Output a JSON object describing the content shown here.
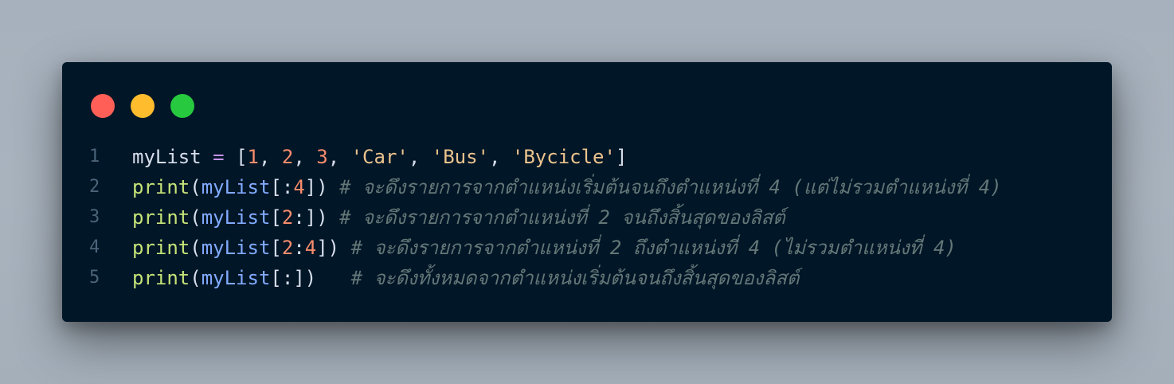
{
  "window": {
    "controls": [
      "close",
      "minimize",
      "maximize"
    ],
    "colors": {
      "background": "#011627",
      "close": "#ff5f56",
      "minimize": "#ffbd2e",
      "maximize": "#27c93f"
    }
  },
  "code": {
    "language": "python",
    "lines": [
      {
        "number": "1",
        "tokens": [
          {
            "t": "myList",
            "c": "var"
          },
          {
            "t": " ",
            "c": "punc"
          },
          {
            "t": "=",
            "c": "op"
          },
          {
            "t": " ",
            "c": "punc"
          },
          {
            "t": "[",
            "c": "brk"
          },
          {
            "t": "1",
            "c": "num"
          },
          {
            "t": ", ",
            "c": "punc"
          },
          {
            "t": "2",
            "c": "num"
          },
          {
            "t": ", ",
            "c": "punc"
          },
          {
            "t": "3",
            "c": "num"
          },
          {
            "t": ", ",
            "c": "punc"
          },
          {
            "t": "'Car'",
            "c": "str"
          },
          {
            "t": ", ",
            "c": "punc"
          },
          {
            "t": "'Bus'",
            "c": "str"
          },
          {
            "t": ", ",
            "c": "punc"
          },
          {
            "t": "'Bycicle'",
            "c": "str"
          },
          {
            "t": "]",
            "c": "brk"
          }
        ]
      },
      {
        "number": "2",
        "tokens": [
          {
            "t": "print",
            "c": "fn"
          },
          {
            "t": "(",
            "c": "punc"
          },
          {
            "t": "myList",
            "c": "arg"
          },
          {
            "t": "[",
            "c": "brk"
          },
          {
            "t": ":",
            "c": "punc"
          },
          {
            "t": "4",
            "c": "num"
          },
          {
            "t": "]",
            "c": "brk"
          },
          {
            "t": ")",
            "c": "punc"
          },
          {
            "t": " ",
            "c": "punc"
          },
          {
            "t": "# จะดึงรายการจากตำแหน่งเริ่มต้นจนถึงตำแหน่งที่ 4 (แต่ไม่รวมตำแหน่งที่ 4)",
            "c": "com"
          }
        ]
      },
      {
        "number": "3",
        "tokens": [
          {
            "t": "print",
            "c": "fn"
          },
          {
            "t": "(",
            "c": "punc"
          },
          {
            "t": "myList",
            "c": "arg"
          },
          {
            "t": "[",
            "c": "brk"
          },
          {
            "t": "2",
            "c": "num"
          },
          {
            "t": ":",
            "c": "punc"
          },
          {
            "t": "]",
            "c": "brk"
          },
          {
            "t": ")",
            "c": "punc"
          },
          {
            "t": " ",
            "c": "punc"
          },
          {
            "t": "# จะดึงรายการจากตำแหน่งที่ 2 จนถึงสิ้นสุดของลิสต์",
            "c": "com"
          }
        ]
      },
      {
        "number": "4",
        "tokens": [
          {
            "t": "print",
            "c": "fn"
          },
          {
            "t": "(",
            "c": "punc"
          },
          {
            "t": "myList",
            "c": "arg"
          },
          {
            "t": "[",
            "c": "brk"
          },
          {
            "t": "2",
            "c": "num"
          },
          {
            "t": ":",
            "c": "punc"
          },
          {
            "t": "4",
            "c": "num"
          },
          {
            "t": "]",
            "c": "brk"
          },
          {
            "t": ")",
            "c": "punc"
          },
          {
            "t": " ",
            "c": "punc"
          },
          {
            "t": "# จะดึงรายการจากตำแหน่งที่ 2 ถึงตำแหน่งที่ 4 (ไม่รวมตำแหน่งที่ 4)",
            "c": "com"
          }
        ]
      },
      {
        "number": "5",
        "tokens": [
          {
            "t": "print",
            "c": "fn"
          },
          {
            "t": "(",
            "c": "punc"
          },
          {
            "t": "myList",
            "c": "arg"
          },
          {
            "t": "[",
            "c": "brk"
          },
          {
            "t": ":",
            "c": "punc"
          },
          {
            "t": "]",
            "c": "brk"
          },
          {
            "t": ")",
            "c": "punc"
          },
          {
            "t": "   ",
            "c": "punc"
          },
          {
            "t": "# จะดึงทั้งหมดจากตำแหน่งเริ่มต้นจนถึงสิ้นสุดของลิสต์",
            "c": "com"
          }
        ]
      }
    ]
  }
}
